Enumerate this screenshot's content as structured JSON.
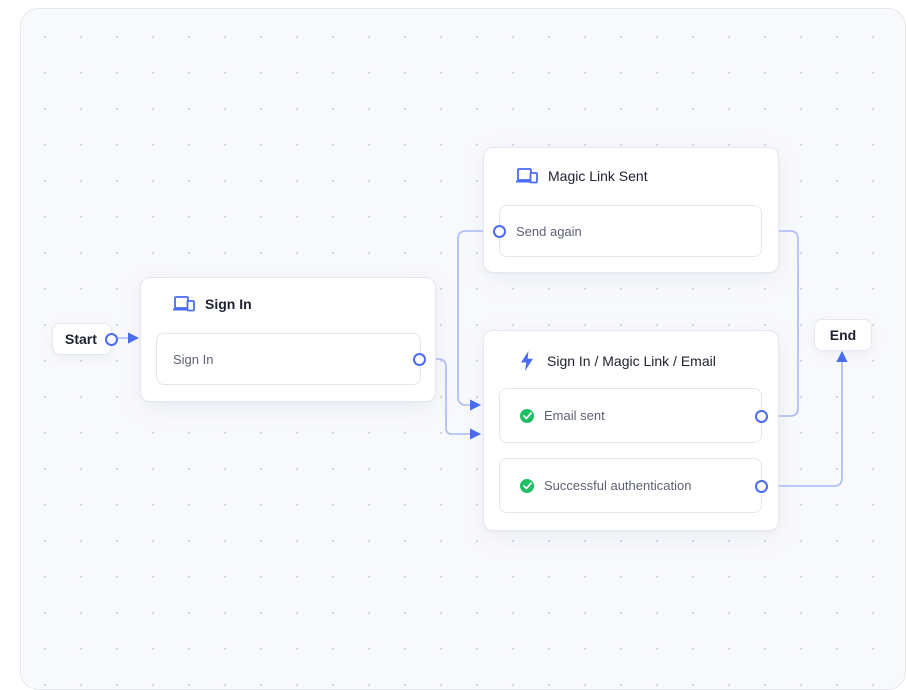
{
  "colors": {
    "accent": "#4a6cf0",
    "edge": "#a9b9f5",
    "success": "#1fbf66"
  },
  "start": {
    "label": "Start"
  },
  "end": {
    "label": "End"
  },
  "nodes": {
    "sign_in": {
      "title": "Sign In",
      "icon": "devices-icon",
      "rows": [
        {
          "label": "Sign In"
        }
      ]
    },
    "magic_link_sent": {
      "title": "Magic Link Sent",
      "icon": "devices-icon",
      "rows": [
        {
          "label": "Send again"
        }
      ]
    },
    "magic_link_email": {
      "title": "Sign In / Magic Link / Email",
      "icon": "lightning-icon",
      "rows": [
        {
          "label": "Email sent",
          "icon": "check-circle-icon"
        },
        {
          "label": "Successful authentication",
          "icon": "check-circle-icon"
        }
      ]
    }
  }
}
